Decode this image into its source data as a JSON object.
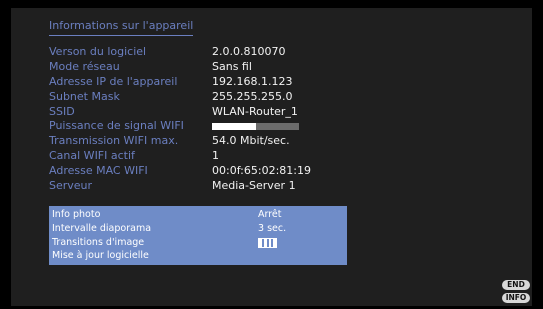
{
  "header": {
    "title": "Informations sur l'appareil"
  },
  "device_info": [
    {
      "label": "Verson du logiciel",
      "value": "2.0.0.810070"
    },
    {
      "label": "Mode réseau",
      "value": "Sans fil"
    },
    {
      "label": "Adresse IP de l'appareil",
      "value": "192.168.1.123"
    },
    {
      "label": "Subnet Mask",
      "value": "255.255.255.0"
    },
    {
      "label": "SSID",
      "value": "WLAN-Router_1"
    },
    {
      "label": "Puissance de signal WIFI",
      "signal_level": 0.5
    },
    {
      "label": "Transmission WIFI max.",
      "value": "54.0 Mbit/sec."
    },
    {
      "label": "Canal WIFI actif",
      "value": "1"
    },
    {
      "label": "Adresse MAC WIFI",
      "value": "00:0f:65:02:81:19"
    },
    {
      "label": "Serveur",
      "value": "Media-Server 1"
    }
  ],
  "menu": [
    {
      "label": "Info photo",
      "value": "Arrêt"
    },
    {
      "label": "Intervalle diaporama",
      "value": "3 sec."
    },
    {
      "label": "Transitions d'image",
      "icon": "transition-bars-icon"
    },
    {
      "label": "Mise à jour logicielle"
    }
  ],
  "remote_keys": {
    "end": "END",
    "info": "INFO"
  },
  "colors": {
    "label": "#6b7fc0",
    "value": "#f2f2f2",
    "menu_bg": "#6f8cc8",
    "panel_bg": "#1f1f1f"
  }
}
